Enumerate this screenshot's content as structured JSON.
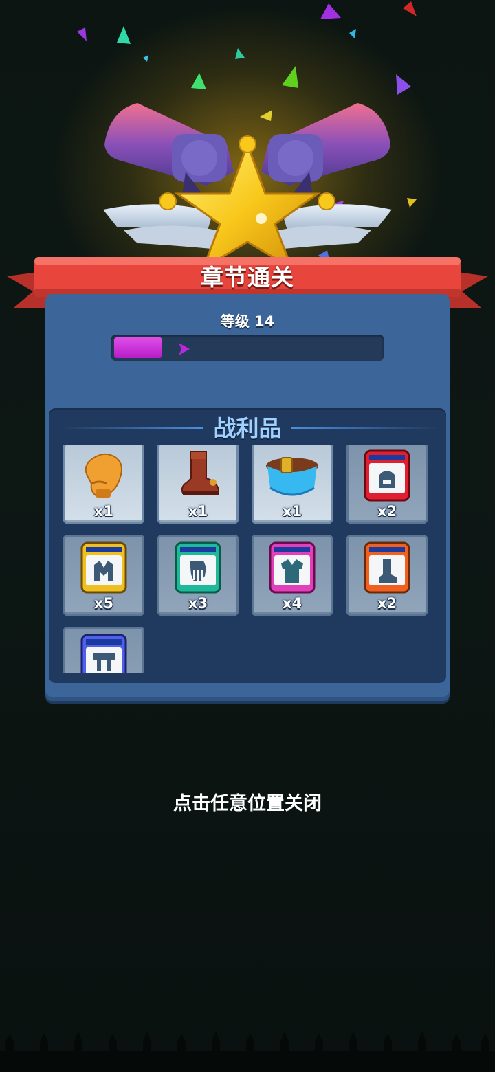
{
  "dialog": {
    "title": "章节通关",
    "level_label": "等级 14",
    "level": 14,
    "xp_progress": 0.18
  },
  "loot": {
    "title": "战利品",
    "items": [
      {
        "icon": "glove-icon",
        "quantity": "x1"
      },
      {
        "icon": "boot-icon",
        "quantity": "x1"
      },
      {
        "icon": "belt-icon",
        "quantity": "x1"
      },
      {
        "icon": "helmet-card-icon",
        "quantity": "x2",
        "color": "#e02030"
      },
      {
        "icon": "armor-card-icon",
        "quantity": "x5",
        "color": "#f0c020"
      },
      {
        "icon": "glove-card-icon",
        "quantity": "x3",
        "color": "#20b89a"
      },
      {
        "icon": "vest-card-icon",
        "quantity": "x4",
        "color": "#e040b8"
      },
      {
        "icon": "boot-card-icon",
        "quantity": "x2",
        "color": "#f06020"
      },
      {
        "icon": "belt-card-icon",
        "quantity": "",
        "color": "#5060e8"
      }
    ]
  },
  "footer": {
    "close_hint": "点击任意位置关闭"
  },
  "colors": {
    "ribbon": "#e8453c",
    "panel": "#3c669a",
    "xp_fill": "#c12fd4",
    "loot_title": "#9fd0ff"
  }
}
